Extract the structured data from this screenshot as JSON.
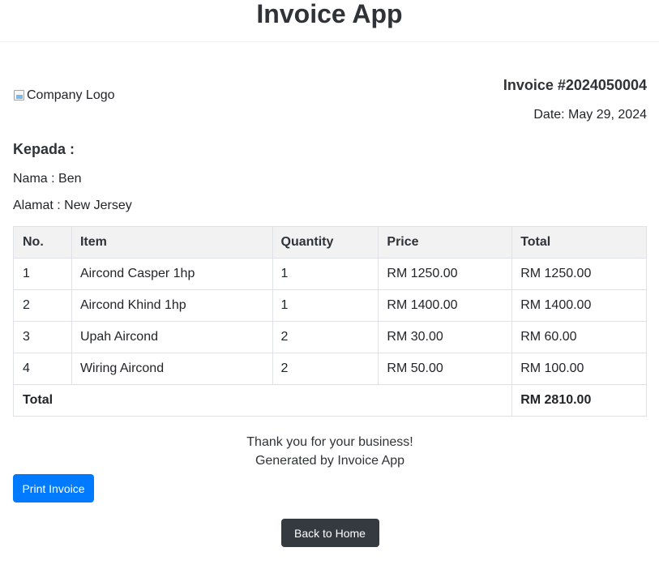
{
  "header": {
    "title": "Invoice App"
  },
  "company": {
    "logo_alt": "Company Logo"
  },
  "invoice": {
    "number": "Invoice #2024050004",
    "date": "Date: May 29, 2024"
  },
  "recipient": {
    "heading": "Kepada :",
    "name_line": "Nama : Ben",
    "address_line": "Alamat : New Jersey"
  },
  "table": {
    "headers": [
      "No.",
      "Item",
      "Quantity",
      "Price",
      "Total"
    ],
    "rows": [
      [
        "1",
        "Aircond Casper 1hp",
        "1",
        "RM 1250.00",
        "RM 1250.00"
      ],
      [
        "2",
        "Aircond Khind 1hp",
        "1",
        "RM 1400.00",
        "RM 1400.00"
      ],
      [
        "3",
        "Upah Aircond",
        "2",
        "RM 30.00",
        "RM 60.00"
      ],
      [
        "4",
        "Wiring Aircond",
        "2",
        "RM 50.00",
        "RM 100.00"
      ]
    ],
    "total_label": "Total",
    "total_value": "RM 2810.00"
  },
  "footer": {
    "thanks": "Thank you for your business!",
    "generated": "Generated by Invoice App"
  },
  "buttons": {
    "print": "Print Invoice",
    "home": "Back to Home"
  },
  "colors": {
    "primary": "#007bff",
    "dark": "#343a40",
    "table_header_bg": "#f2f2f2"
  },
  "icons": {
    "logo": "broken-image-icon"
  }
}
